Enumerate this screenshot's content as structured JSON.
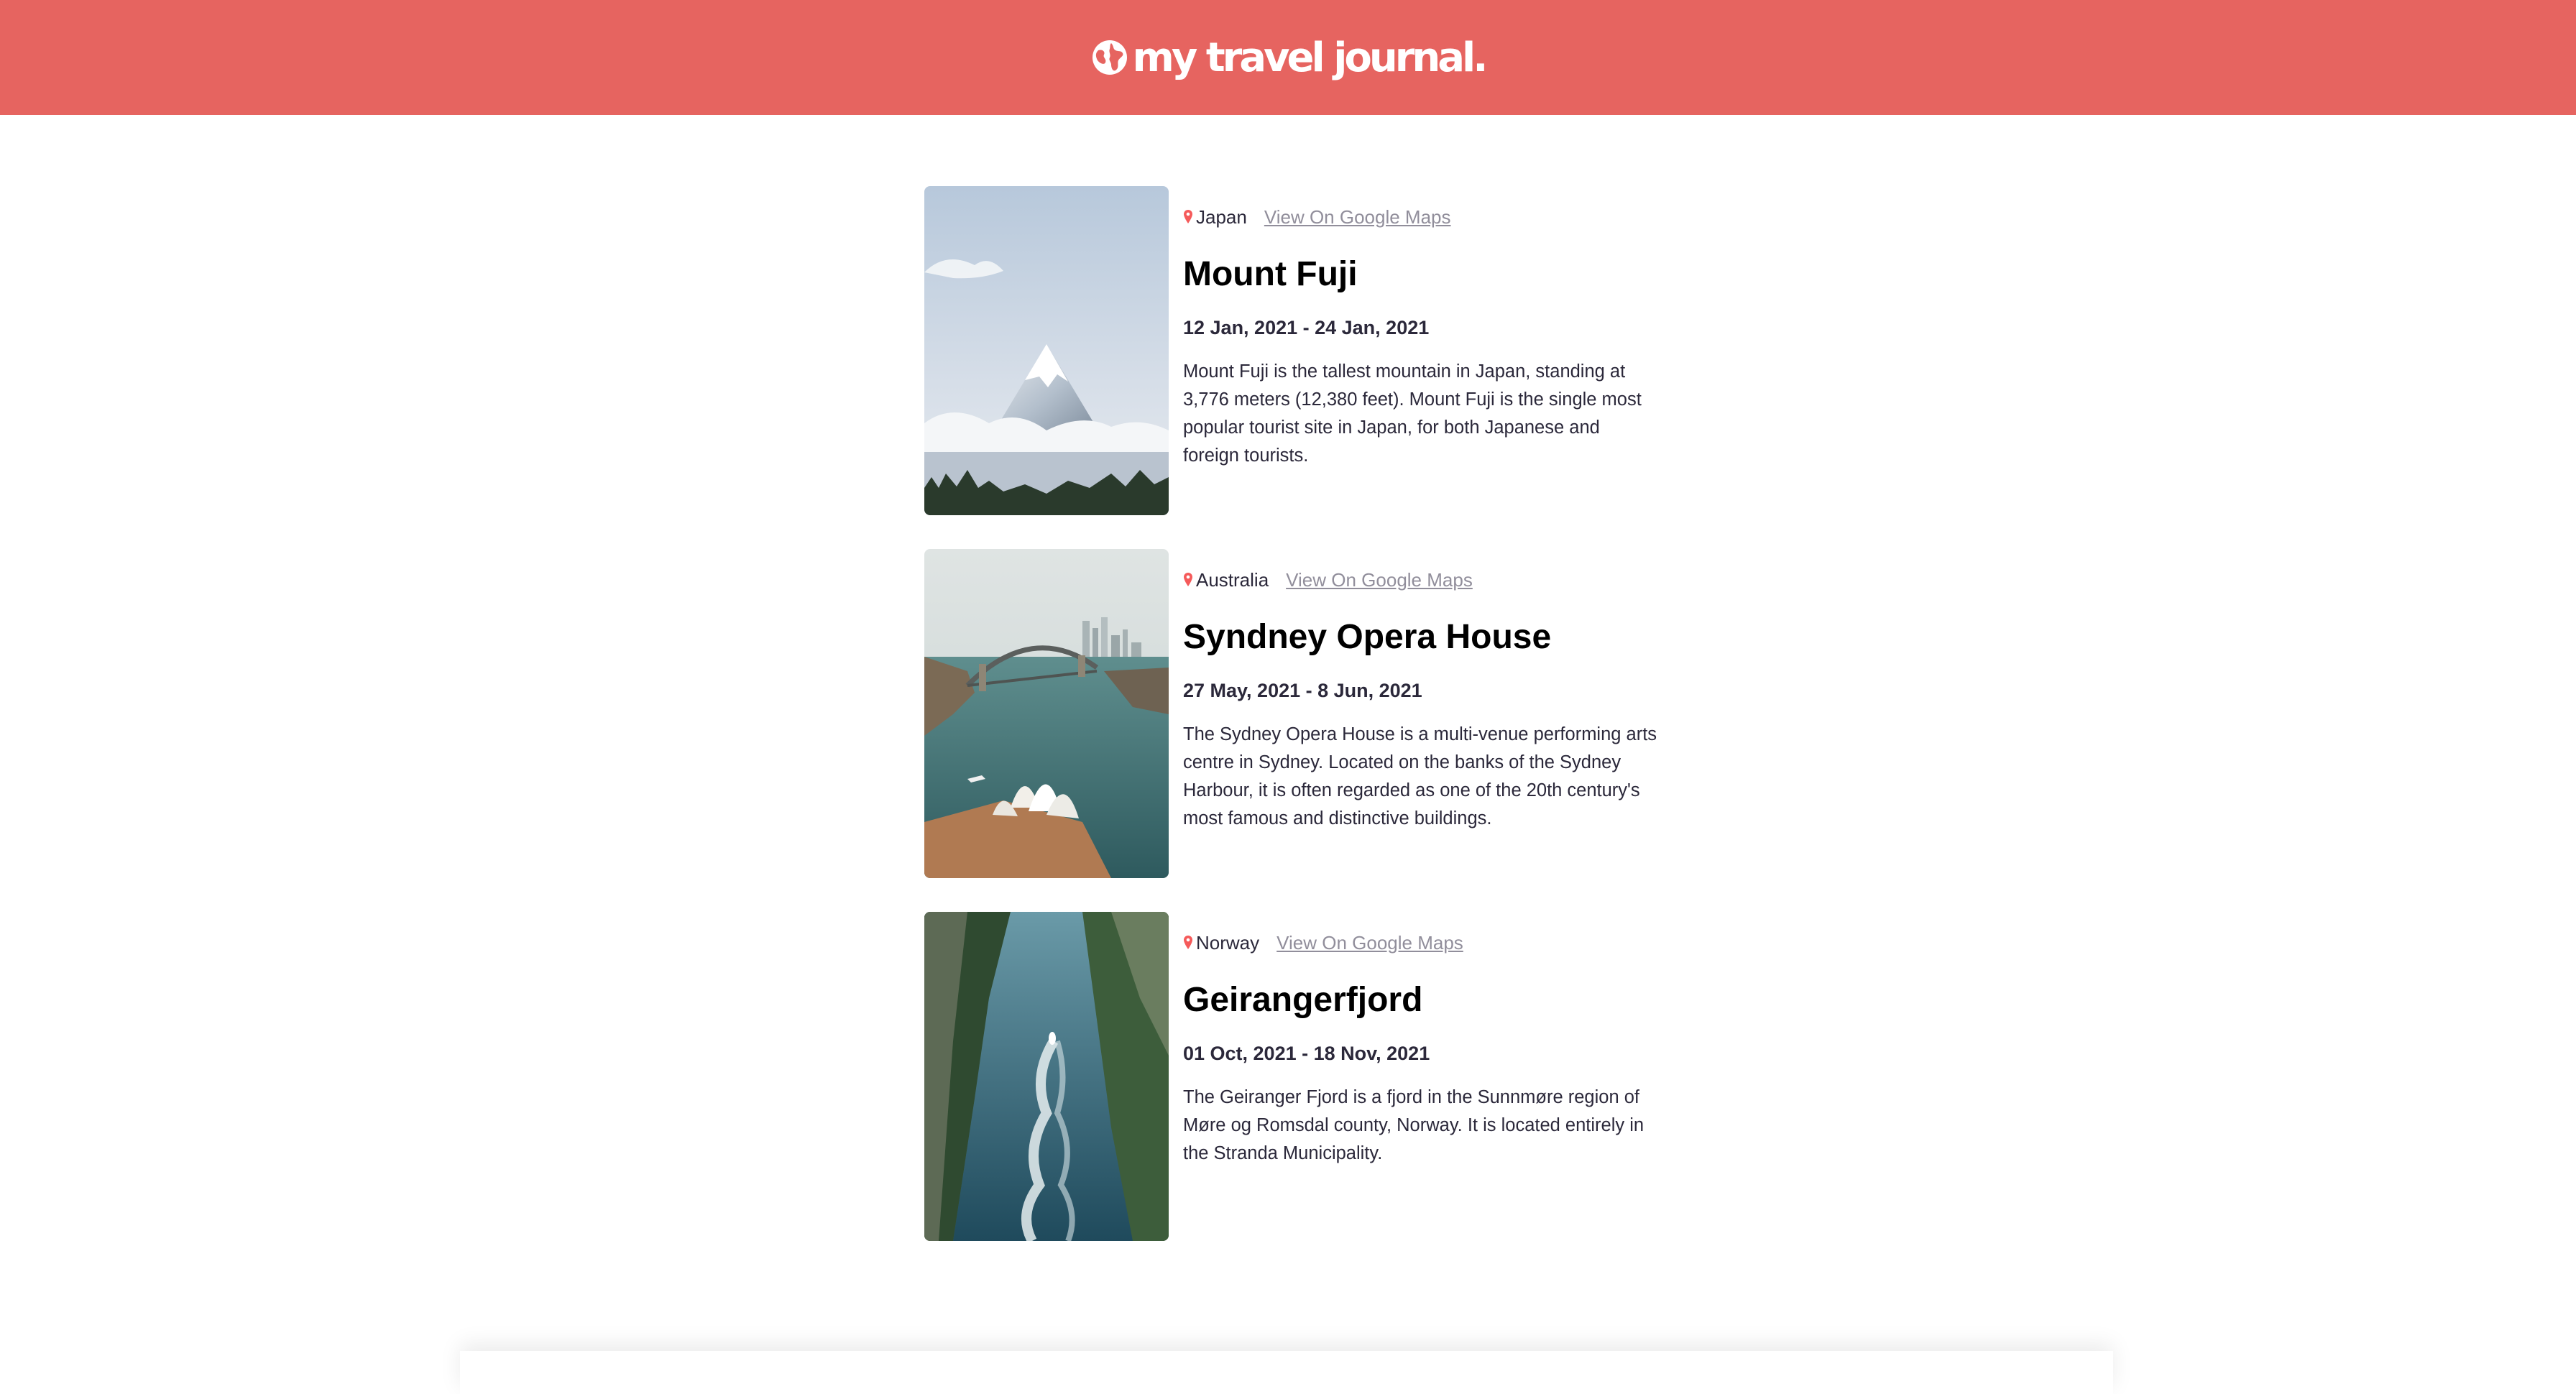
{
  "header": {
    "brand_text": "my travel journal.",
    "icon": "globe-icon",
    "color": "#e66460"
  },
  "entries": [
    {
      "country": "Japan",
      "maps_link": "View On Google Maps",
      "title": "Mount Fuji",
      "dates": "12 Jan, 2021 - 24 Jan, 2021",
      "description": "Mount Fuji is the tallest mountain in Japan, standing at 3,776 meters (12,380 feet). Mount Fuji is the single most popular tourist site in Japan, for both Japanese and foreign tourists."
    },
    {
      "country": "Australia",
      "maps_link": "View On Google Maps",
      "title": "Syndney Opera House",
      "dates": "27 May, 2021 - 8 Jun, 2021",
      "description": "The Sydney Opera House is a multi-venue performing arts centre in Sydney. Located on the banks of the Sydney Harbour, it is often regarded as one of the 20th century's most famous and distinctive buildings."
    },
    {
      "country": "Norway",
      "maps_link": "View On Google Maps",
      "title": "Geirangerfjord",
      "dates": "01 Oct, 2021 - 18 Nov, 2021",
      "description": "The Geiranger Fjord is a fjord in the Sunnmøre region of Møre og Romsdal county, Norway. It is located entirely in the Stranda Municipality."
    }
  ]
}
